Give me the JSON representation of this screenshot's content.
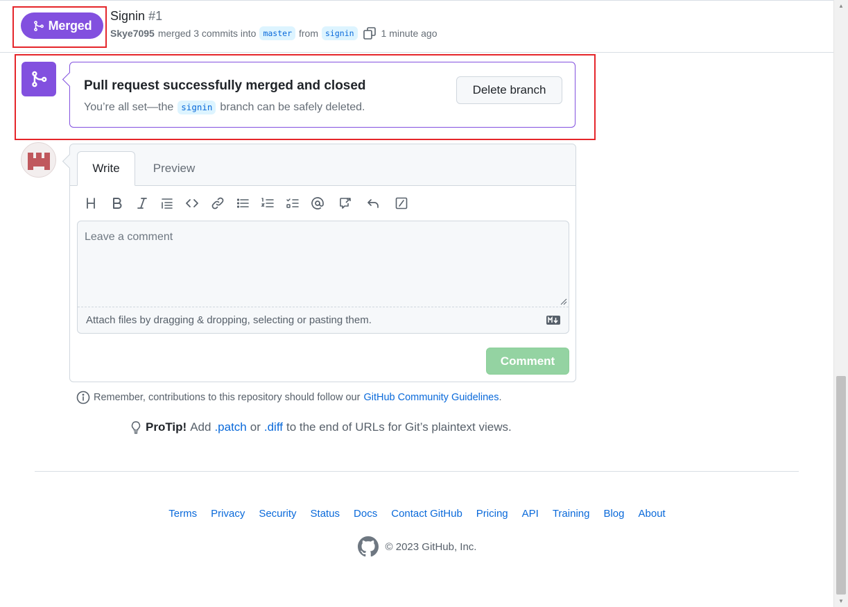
{
  "pr": {
    "state": "Merged",
    "title": "Signin",
    "number": "#1",
    "author": "Skye7095",
    "merge_text": "merged 3 commits into",
    "base_branch": "master",
    "from_text": "from",
    "head_branch": "signin",
    "time": "1 minute ago"
  },
  "merge_box": {
    "title": "Pull request successfully merged and closed",
    "subtitle_pre": "You’re all set—the",
    "branch": "signin",
    "subtitle_post": "branch can be safely deleted.",
    "delete_button": "Delete branch"
  },
  "comment_form": {
    "tabs": [
      "Write",
      "Preview"
    ],
    "placeholder": "Leave a comment",
    "attach_text": "Attach files by dragging & dropping, selecting or pasting them.",
    "submit_label": "Comment"
  },
  "toolbar_icons": [
    "heading-icon",
    "bold-icon",
    "italic-icon",
    "quote-icon",
    "code-icon",
    "link-icon",
    "unordered-list-icon",
    "ordered-list-icon",
    "task-list-icon",
    "mention-icon",
    "cross-reference-icon",
    "reply-icon",
    "slash-commands-icon"
  ],
  "guidelines": {
    "pre": "Remember, contributions to this repository should follow our",
    "link": "GitHub Community Guidelines",
    "post": "."
  },
  "protip": {
    "label": "ProTip!",
    "pre": "Add",
    "patch": ".patch",
    "or": "or",
    "diff": ".diff",
    "post": "to the end of URLs for Git’s plaintext views."
  },
  "footer": {
    "links": [
      "Terms",
      "Privacy",
      "Security",
      "Status",
      "Docs",
      "Contact GitHub",
      "Pricing",
      "API",
      "Training",
      "Blog",
      "About"
    ],
    "copyright": "© 2023 GitHub, Inc."
  },
  "colors": {
    "merged_purple": "#8250df",
    "link_blue": "#0969da",
    "comment_green_disabled": "#94d3a2",
    "highlight_red": "#e5252a"
  }
}
